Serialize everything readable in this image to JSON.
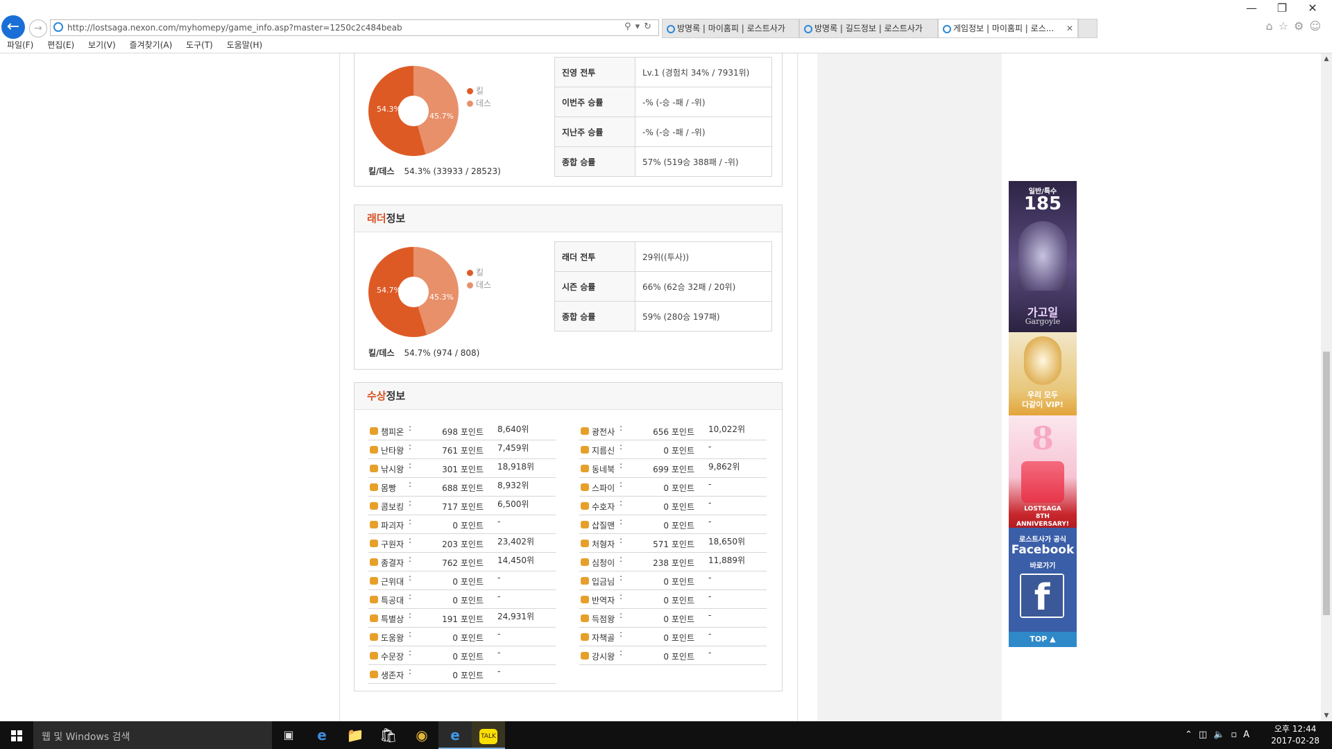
{
  "browser": {
    "url": "http://lostsaga.nexon.com/myhomepy/game_info.asp?master=1250c2c484beab",
    "tabs": [
      {
        "label": "방명록 | 마이홈피 | 로스트사가"
      },
      {
        "label": "방명록 | 길드정보 | 로스트사가"
      },
      {
        "label": "게임정보 | 마이홈피 | 로스..."
      }
    ],
    "menu": [
      "파일(F)",
      "편집(E)",
      "보기(V)",
      "즐겨찾기(A)",
      "도구(T)",
      "도움말(H)"
    ]
  },
  "camp": {
    "donut": {
      "kill_pct": 54.3,
      "death_pct": 45.7,
      "kill_label": "54.3%",
      "death_label": "45.7%"
    },
    "legend": {
      "kill": "킬",
      "death": "데스"
    },
    "kd_label": "킬/데스",
    "kd_value": "54.3% (33933 / 28523)",
    "rows": [
      {
        "k": "진영 전투",
        "v": "Lv.1 (경험치 34% / 7931위)"
      },
      {
        "k": "이번주 승률",
        "v": "-% (-승 -패 / -위)"
      },
      {
        "k": "지난주 승률",
        "v": "-% (-승 -패 / -위)"
      },
      {
        "k": "종합 승률",
        "v": "57% (519승 388패 / -위)"
      }
    ]
  },
  "ladder": {
    "title_hl": "래더",
    "title_rest": "정보",
    "donut": {
      "kill_pct": 54.7,
      "death_pct": 45.3,
      "kill_label": "54.7%",
      "death_label": "45.3%"
    },
    "legend": {
      "kill": "킬",
      "death": "데스"
    },
    "kd_label": "킬/데스",
    "kd_value": "54.7% (974 / 808)",
    "rows": [
      {
        "k": "래더 전투",
        "v": "29위((투사))"
      },
      {
        "k": "시즌 승률",
        "v": "66% (62승 32패 / 20위)"
      },
      {
        "k": "종합 승률",
        "v": "59% (280승 197패)"
      }
    ]
  },
  "awards": {
    "title_hl": "수상",
    "title_rest": "정보",
    "left": [
      {
        "name": "챔피온",
        "points": "698 포인트",
        "rank": "8,640위"
      },
      {
        "name": "난타왕",
        "points": "761 포인트",
        "rank": "7,459위"
      },
      {
        "name": "낚시왕",
        "points": "301 포인트",
        "rank": "18,918위"
      },
      {
        "name": "몸빵",
        "points": "688 포인트",
        "rank": "8,932위"
      },
      {
        "name": "콤보킹",
        "points": "717 포인트",
        "rank": "6,500위"
      },
      {
        "name": "파괴자",
        "points": "0 포인트",
        "rank": "-"
      },
      {
        "name": "구원자",
        "points": "203 포인트",
        "rank": "23,402위"
      },
      {
        "name": "종결자",
        "points": "762 포인트",
        "rank": "14,450위"
      },
      {
        "name": "근위대",
        "points": "0 포인트",
        "rank": "-"
      },
      {
        "name": "특공대",
        "points": "0 포인트",
        "rank": "-"
      },
      {
        "name": "특별상",
        "points": "191 포인트",
        "rank": "24,931위"
      },
      {
        "name": "도움왕",
        "points": "0 포인트",
        "rank": "-"
      },
      {
        "name": "수문장",
        "points": "0 포인트",
        "rank": "-"
      },
      {
        "name": "생존자",
        "points": "0 포인트",
        "rank": "-"
      }
    ],
    "right": [
      {
        "name": "광전사",
        "points": "656 포인트",
        "rank": "10,022위"
      },
      {
        "name": "지름신",
        "points": "0 포인트",
        "rank": "-"
      },
      {
        "name": "동네북",
        "points": "699 포인트",
        "rank": "9,862위"
      },
      {
        "name": "스파이",
        "points": "0 포인트",
        "rank": "-"
      },
      {
        "name": "수호자",
        "points": "0 포인트",
        "rank": "-"
      },
      {
        "name": "삽질맨",
        "points": "0 포인트",
        "rank": "-"
      },
      {
        "name": "처형자",
        "points": "571 포인트",
        "rank": "18,650위"
      },
      {
        "name": "심청이",
        "points": "238 포인트",
        "rank": "11,889위"
      },
      {
        "name": "입금님",
        "points": "0 포인트",
        "rank": "-"
      },
      {
        "name": "반역자",
        "points": "0 포인트",
        "rank": "-"
      },
      {
        "name": "득점왕",
        "points": "0 포인트",
        "rank": "-"
      },
      {
        "name": "자책골",
        "points": "0 포인트",
        "rank": "-"
      },
      {
        "name": "강시왕",
        "points": "0 포인트",
        "rank": "-"
      }
    ]
  },
  "banner": {
    "b1_top": "일반/특수",
    "b1_num": "185",
    "b1_name": "가고일",
    "b1_sub": "Gargoyle",
    "b2_text": "우리 모두\n다같이 VIP!",
    "b3_num": "8",
    "b3_text": "LOSTSAGA\n8TH ANNIVERSARY!",
    "b4_top": "로스트사가 공식",
    "b4_brand": "Facebook",
    "b4_sub": "바로가기",
    "top_button": "TOP ▲"
  },
  "taskbar": {
    "search_placeholder": "웹 및 Windows 검색",
    "time": "오후 12:44",
    "date": "2017-02-28",
    "ime": "A"
  },
  "colors": {
    "kill": "#de5a25",
    "death": "#e8906a",
    "accent": "#d6501f"
  }
}
